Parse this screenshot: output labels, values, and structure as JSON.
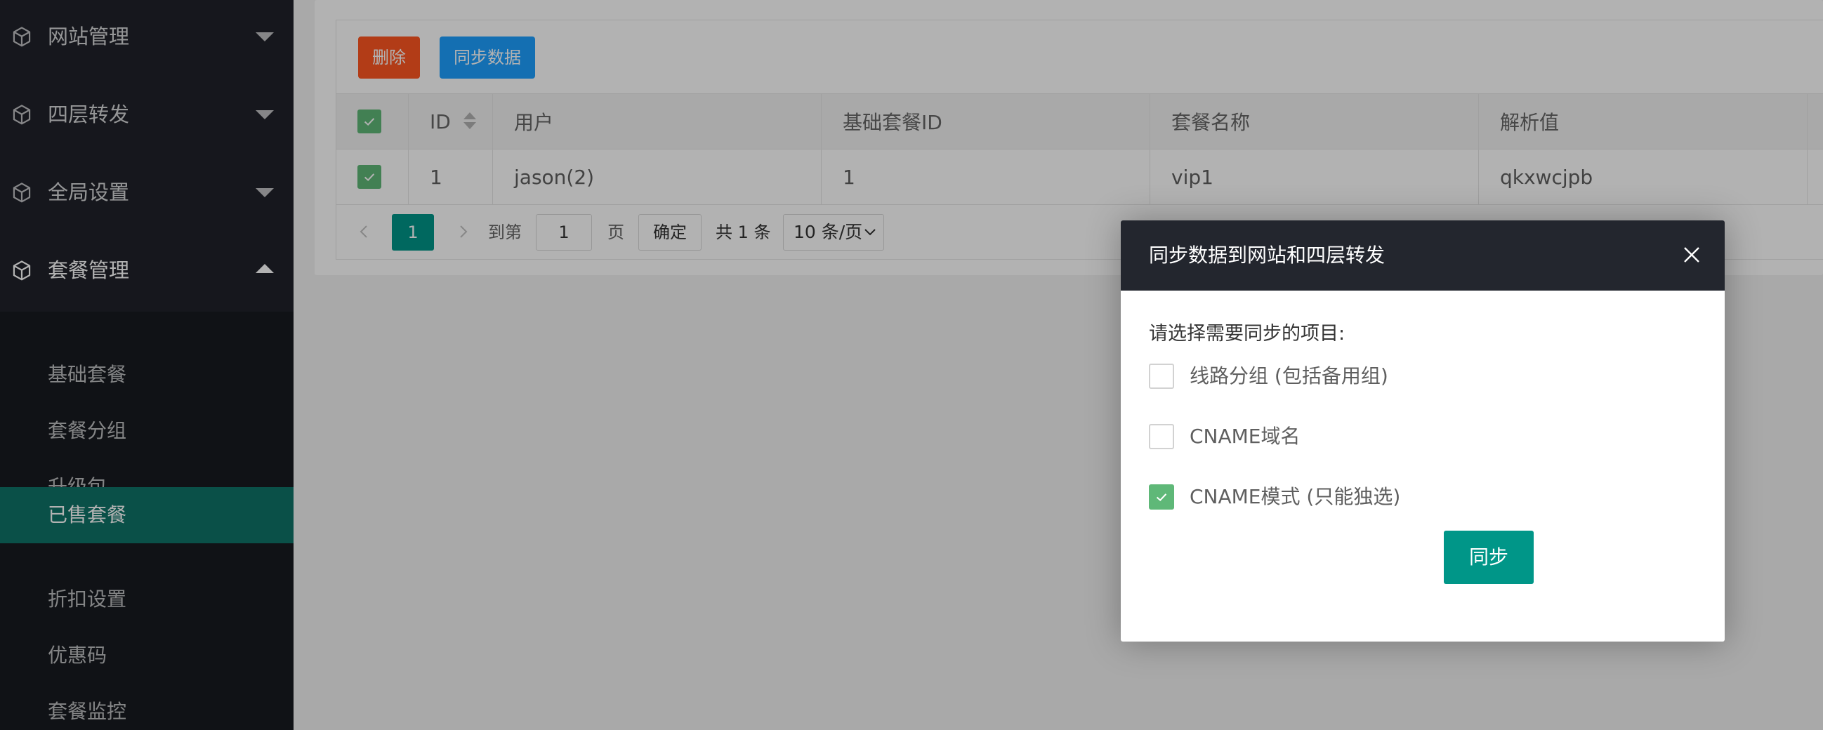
{
  "sidebar": {
    "groups": [
      {
        "label": "网站管理",
        "icon": "cube-icon",
        "expanded": false
      },
      {
        "label": "四层转发",
        "icon": "cube-icon",
        "expanded": false
      },
      {
        "label": "全局设置",
        "icon": "cube-icon",
        "expanded": false
      },
      {
        "label": "套餐管理",
        "icon": "cube-icon",
        "expanded": true
      }
    ],
    "submenu": [
      {
        "label": "基础套餐"
      },
      {
        "label": "套餐分组"
      },
      {
        "label": "升级包"
      },
      {
        "label": "已售套餐",
        "active": true
      },
      {
        "label": "折扣设置"
      },
      {
        "label": "优惠码"
      },
      {
        "label": "套餐监控"
      }
    ]
  },
  "toolbar": {
    "delete_label": "删除",
    "sync_label": "同步数据"
  },
  "table": {
    "headers": [
      "ID",
      "用户",
      "基础套餐ID",
      "套餐名称",
      "解析值"
    ],
    "header_checked": true,
    "rows": [
      {
        "checked": true,
        "cells": [
          "1",
          "jason(2)",
          "1",
          "vip1",
          "qkxwcjpb"
        ]
      }
    ]
  },
  "pagination": {
    "current_page": "1",
    "goto_prefix": "到第",
    "goto_value": "1",
    "goto_suffix": "页",
    "confirm_label": "确定",
    "total_text": "共 1 条",
    "page_size": "10 条/页"
  },
  "modal": {
    "title": "同步数据到网站和四层转发",
    "prompt": "请选择需要同步的项目:",
    "options": [
      {
        "label": "线路分组 (包括备用组)",
        "checked": false
      },
      {
        "label": "CNAME域名",
        "checked": false
      },
      {
        "label": "CNAME模式 (只能独选)",
        "checked": true
      }
    ],
    "confirm_label": "同步"
  },
  "colors": {
    "sidebar_bg": "#20222a",
    "submenu_bg": "#171a20",
    "active_item": "#0f7368",
    "danger": "#ff5722",
    "primary": "#1e9fff",
    "teal": "#009688",
    "check_green": "#5fb878",
    "modal_header": "#23262e"
  }
}
